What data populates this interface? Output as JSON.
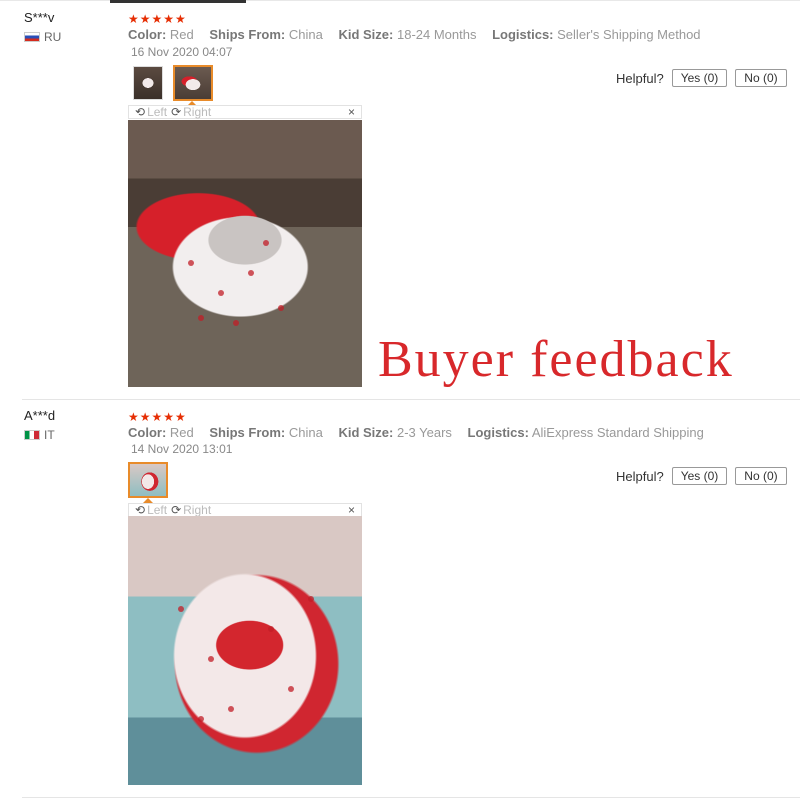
{
  "reviews": [
    {
      "user": "S***v",
      "country": "RU",
      "stars": "★★★★★",
      "attributes": [
        {
          "key": "Color:",
          "value": "Red"
        },
        {
          "key": "Ships From:",
          "value": "China"
        },
        {
          "key": "Kid Size:",
          "value": "18-24 Months"
        },
        {
          "key": "Logistics:",
          "value": "Seller's Shipping Method"
        }
      ],
      "date": "16 Nov 2020 04:07",
      "helpful_label": "Helpful?",
      "yes_label": "Yes (0)",
      "no_label": "No (0)",
      "viewer": {
        "left": "Left",
        "right": "Right",
        "close": "×"
      }
    },
    {
      "user": "A***d",
      "country": "IT",
      "stars": "★★★★★",
      "attributes": [
        {
          "key": "Color:",
          "value": "Red"
        },
        {
          "key": "Ships From:",
          "value": "China"
        },
        {
          "key": "Kid Size:",
          "value": "2-3 Years"
        },
        {
          "key": "Logistics:",
          "value": "AliExpress Standard Shipping"
        }
      ],
      "date": "14 Nov 2020 13:01",
      "helpful_label": "Helpful?",
      "yes_label": "Yes (0)",
      "no_label": "No (0)",
      "viewer": {
        "left": "Left",
        "right": "Right",
        "close": "×"
      }
    }
  ],
  "overlay_text": "Buyer feedback",
  "colors": {
    "stars": "#e62e04",
    "active_thumb": "#e88b2a",
    "overlay": "#d8282b"
  }
}
